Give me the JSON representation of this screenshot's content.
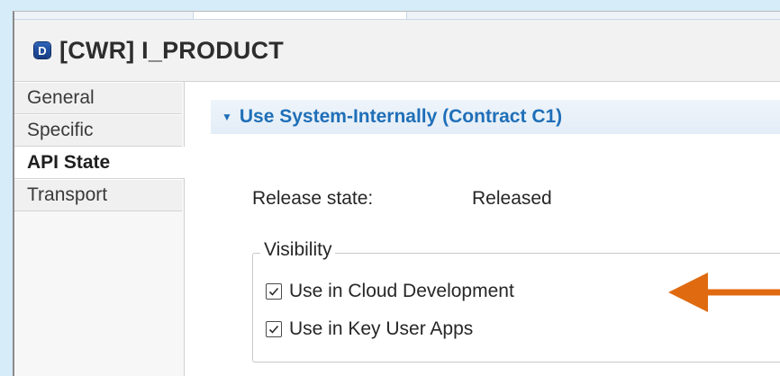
{
  "editor": {
    "icon_letter": "D",
    "title": "[CWR] I_PRODUCT"
  },
  "sidebar": {
    "tabs": [
      {
        "label": "General",
        "active": false
      },
      {
        "label": "Specific",
        "active": false
      },
      {
        "label": "API State",
        "active": true
      },
      {
        "label": "Transport",
        "active": false
      }
    ]
  },
  "section": {
    "title": "Use System-Internally (Contract C1)",
    "expanded": true
  },
  "release": {
    "label": "Release state:",
    "value": "Released"
  },
  "visibility": {
    "legend": "Visibility",
    "options": [
      {
        "label": "Use in Cloud Development",
        "checked": true
      },
      {
        "label": "Use in Key User Apps",
        "checked": true
      }
    ]
  },
  "colors": {
    "accent": "#1f6fb8",
    "annotation_arrow": "#e06a10",
    "background": "#d6ecf9"
  },
  "icons": {
    "editor_type": "d-icon",
    "section_toggle": "chevron-down-icon",
    "checkbox_mark": "checkmark-icon",
    "annotation": "arrow-left-icon"
  }
}
